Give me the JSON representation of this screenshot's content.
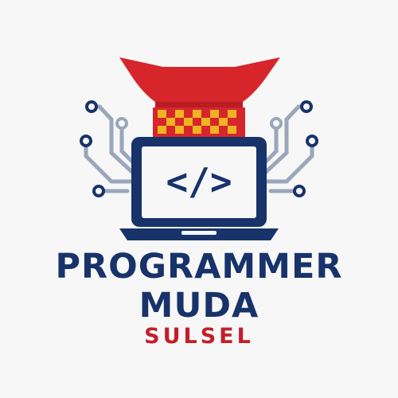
{
  "logo": {
    "line1": "PROGRAMMER",
    "line2": "MUDA",
    "line3": "SULSEL",
    "code_symbol": "</>",
    "colors": {
      "navy": "#17336a",
      "red": "#c21f2a",
      "roof_red": "#d7262b",
      "gold": "#f0b323",
      "circuit": "#9aa7ba",
      "background": "#f7f7f7"
    },
    "icons": [
      "tongkonan-roof-icon",
      "laptop-icon",
      "code-brackets-icon",
      "circuit-traces-icon"
    ]
  }
}
